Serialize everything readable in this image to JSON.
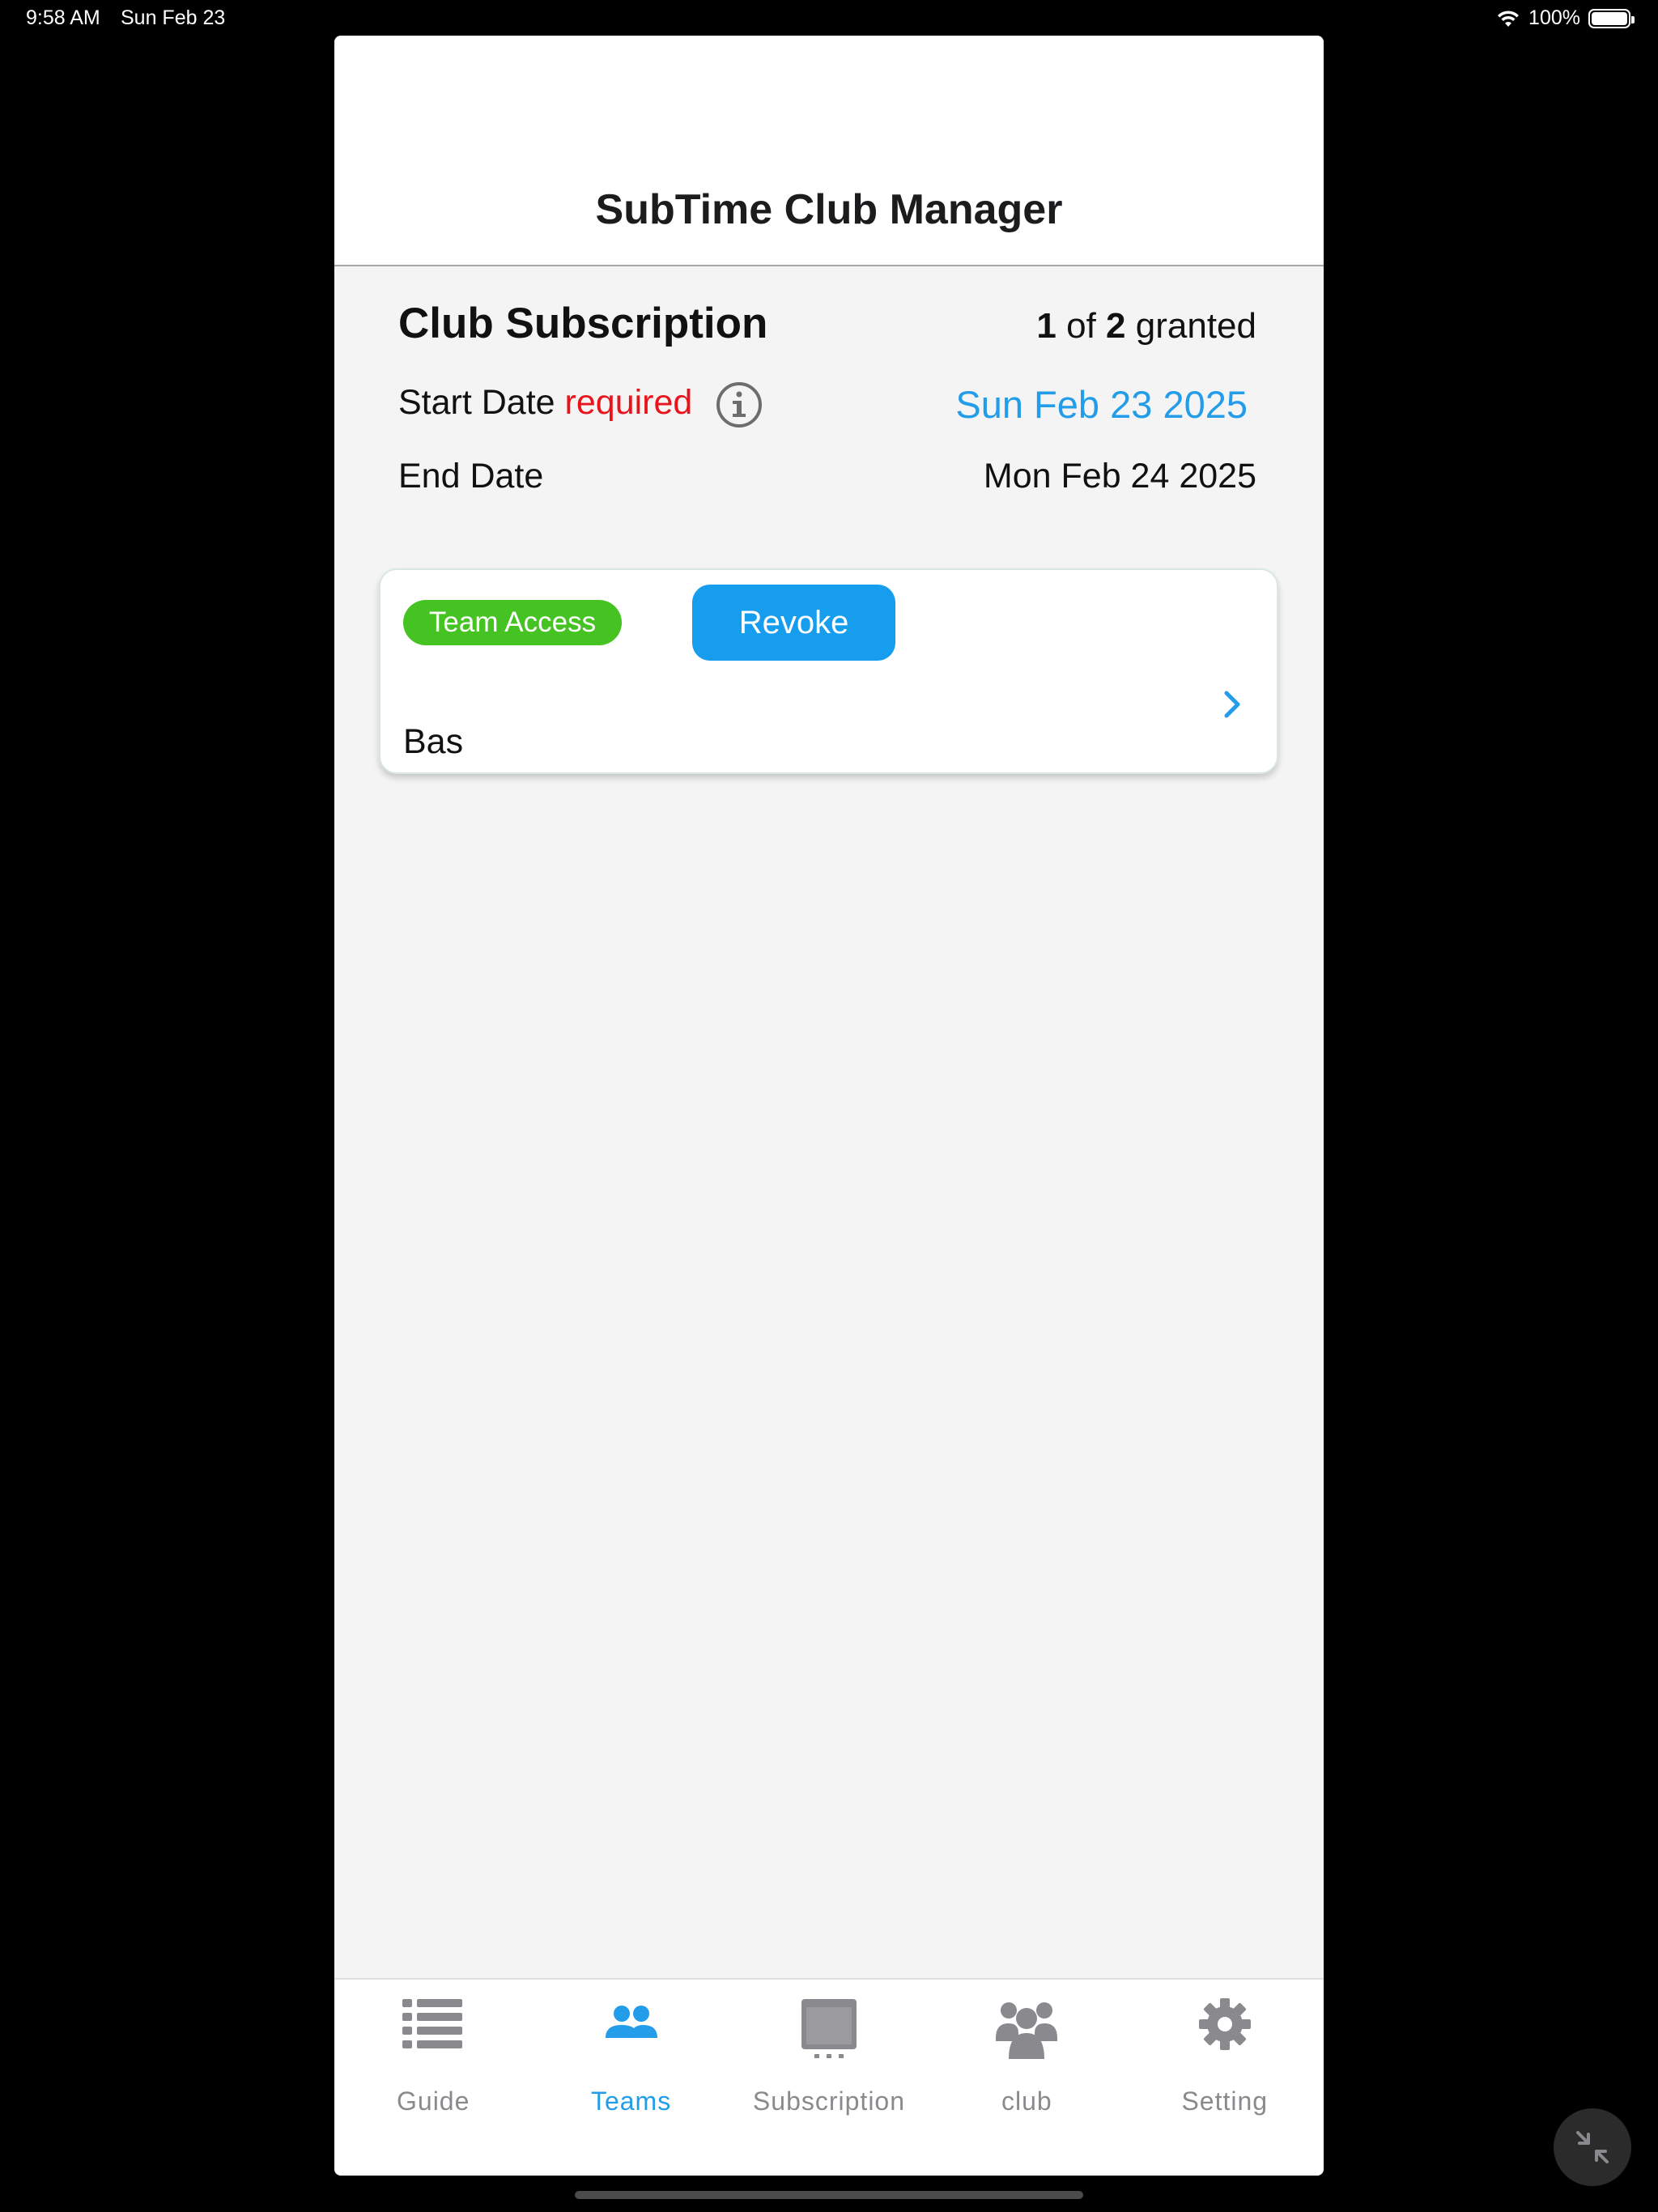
{
  "status_bar": {
    "time": "9:58 AM",
    "date": "Sun Feb 23",
    "battery": "100%"
  },
  "header": {
    "title": "SubTime Club Manager"
  },
  "subscription": {
    "title": "Club Subscription",
    "granted_count": "1",
    "granted_of": "of",
    "granted_total": "2",
    "granted_word": "granted",
    "start_label": "Start Date",
    "required_label": "required",
    "start_value": "Sun Feb 23 2025",
    "end_label": "End Date",
    "end_value": "Mon Feb 24 2025"
  },
  "team_card": {
    "badge": "Team Access",
    "revoke_label": "Revoke",
    "team_name": "Bas"
  },
  "tabs": [
    {
      "label": "Guide",
      "icon": "list-icon",
      "active": false
    },
    {
      "label": "Teams",
      "icon": "teams-icon",
      "active": true
    },
    {
      "label": "Subscription",
      "icon": "subscription-icon",
      "active": false
    },
    {
      "label": "club",
      "icon": "club-icon",
      "active": false
    },
    {
      "label": "Setting",
      "icon": "gear-icon",
      "active": false
    }
  ],
  "colors": {
    "accent": "#239ce9",
    "required": "#e9141b",
    "badge": "#45c322",
    "revoke_button": "#169ded",
    "inactive_tab": "#8a8a8e"
  }
}
